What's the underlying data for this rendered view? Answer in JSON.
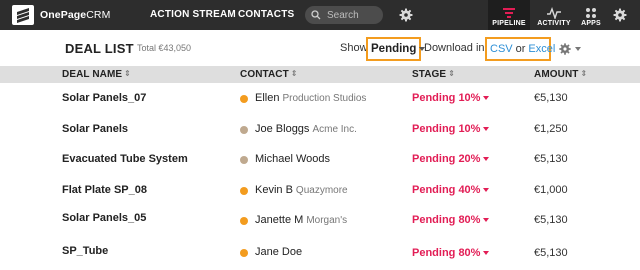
{
  "nav": {
    "logo_bold": "OnePage",
    "logo_thin": "CRM",
    "links": [
      "ACTION STREAM",
      "CONTACTS"
    ],
    "search_placeholder": "Search",
    "apps": [
      {
        "label": "PIPELINE",
        "icon": "pipeline-icon",
        "active": true
      },
      {
        "label": "ACTIVITY",
        "icon": "activity-icon",
        "active": false
      },
      {
        "label": "APPS",
        "icon": "apps-icon",
        "active": false
      }
    ]
  },
  "header": {
    "title": "DEAL LIST",
    "total": "Total €43,050",
    "show_label": "Show",
    "filter_value": "Pending",
    "download_label": "Download in",
    "download_csv": "CSV",
    "download_or": "or",
    "download_excel": "Excel"
  },
  "columns": {
    "deal_name": "DEAL NAME",
    "contact": "CONTACT",
    "stage": "STAGE",
    "amount": "AMOUNT",
    "sort_glyph": "⇕"
  },
  "rows": [
    {
      "deal": "Solar Panels_07",
      "contact": "Ellen",
      "company": "Production Studios",
      "dot_color": "#f39c1f",
      "stage": "Pending 10%",
      "amount": "€5,130"
    },
    {
      "deal": "Solar Panels",
      "contact": "Joe Bloggs",
      "company": "Acme Inc.",
      "dot_color": "#bfa98f",
      "stage": "Pending 10%",
      "amount": "€1,250"
    },
    {
      "deal": "Evacuated Tube System",
      "contact": "Michael Woods",
      "company": "",
      "dot_color": "#bfa98f",
      "stage": "Pending 20%",
      "amount": "€5,130"
    },
    {
      "deal": "Flat Plate SP_08",
      "contact": "Kevin B",
      "company": "Quazymore",
      "dot_color": "#f39c1f",
      "stage": "Pending 40%",
      "amount": "€1,000"
    },
    {
      "deal": "Solar Panels_05",
      "contact": "Janette M",
      "company": "Morgan's",
      "dot_color": "#f39c1f",
      "stage": "Pending 80%",
      "amount": "€5,130"
    },
    {
      "deal": "SP_Tube",
      "contact": "Jane Doe",
      "company": "",
      "dot_color": "#f39c1f",
      "stage": "Pending 80%",
      "amount": "€5,130"
    }
  ],
  "colors": {
    "accent_orange": "#f39c1f",
    "stage_pink": "#e21d55",
    "link_blue": "#2d8fd6",
    "topbar": "#2d2d2d"
  }
}
